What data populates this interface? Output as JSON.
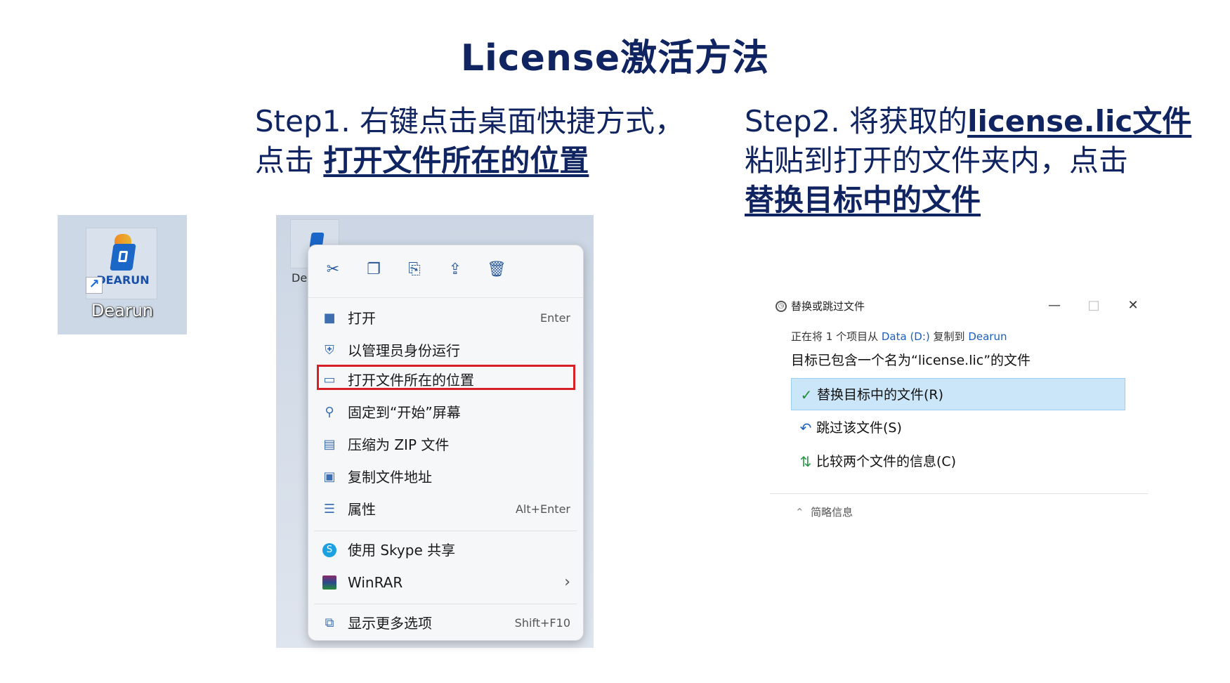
{
  "title": "License激活方法",
  "step1": {
    "prefix": "Step1. 右键点击桌面快捷方式，",
    "line2_prefix": "点击 ",
    "emphasis": "打开文件所在的位置"
  },
  "step2": {
    "prefix": "Step2. 将获取的",
    "emphasis1": "license.lic文件",
    "middle": "粘贴到打开的文件夹内，点击",
    "emphasis2": "替换目标中的文件"
  },
  "desktop_icon": {
    "logo_text": "DEARUN",
    "label": "Dearun",
    "shortcut_icon": "shortcut-arrow-icon"
  },
  "context_menu": {
    "mini_label": "De",
    "toolbar": [
      "cut-icon",
      "copy-icon",
      "rename-icon",
      "share-icon",
      "delete-icon"
    ],
    "items": [
      {
        "icon": "open-icon",
        "label": "打开",
        "shortcut": "Enter"
      },
      {
        "icon": "admin-shield-icon",
        "label": "以管理员身份运行",
        "shortcut": ""
      },
      {
        "icon": "folder-icon",
        "label": "打开文件所在的位置",
        "shortcut": "",
        "highlighted": true
      },
      {
        "icon": "pin-icon",
        "label": "固定到“开始”屏幕",
        "shortcut": ""
      },
      {
        "icon": "zip-icon",
        "label": "压缩为 ZIP 文件",
        "shortcut": ""
      },
      {
        "icon": "copy-path-icon",
        "label": "复制文件地址",
        "shortcut": ""
      },
      {
        "icon": "properties-icon",
        "label": "属性",
        "shortcut": "Alt+Enter"
      },
      {
        "icon": "skype-icon",
        "label": "使用 Skype 共享",
        "shortcut": ""
      },
      {
        "icon": "winrar-icon",
        "label": "WinRAR",
        "shortcut": "›"
      },
      {
        "icon": "more-options-icon",
        "label": "显示更多选项",
        "shortcut": "Shift+F10"
      }
    ],
    "highlight_color": "#d61f26"
  },
  "dialog": {
    "title": "替换或跳过文件",
    "copy_prefix": "正在将 1 个项目从 ",
    "source": "Data (D:)",
    "copy_middle": " 复制到 ",
    "destination": "Dearun",
    "message": "目标已包含一个名为“license.lic”的文件",
    "options": [
      {
        "icon": "checkmark-icon",
        "label": "替换目标中的文件(R)",
        "selected": true
      },
      {
        "icon": "skip-arrow-icon",
        "label": "跳过该文件(S)",
        "selected": false
      },
      {
        "icon": "compare-icon",
        "label": "比较两个文件的信息(C)",
        "selected": false
      }
    ],
    "footer": "简略信息",
    "accent_color": "#cce6f9"
  }
}
